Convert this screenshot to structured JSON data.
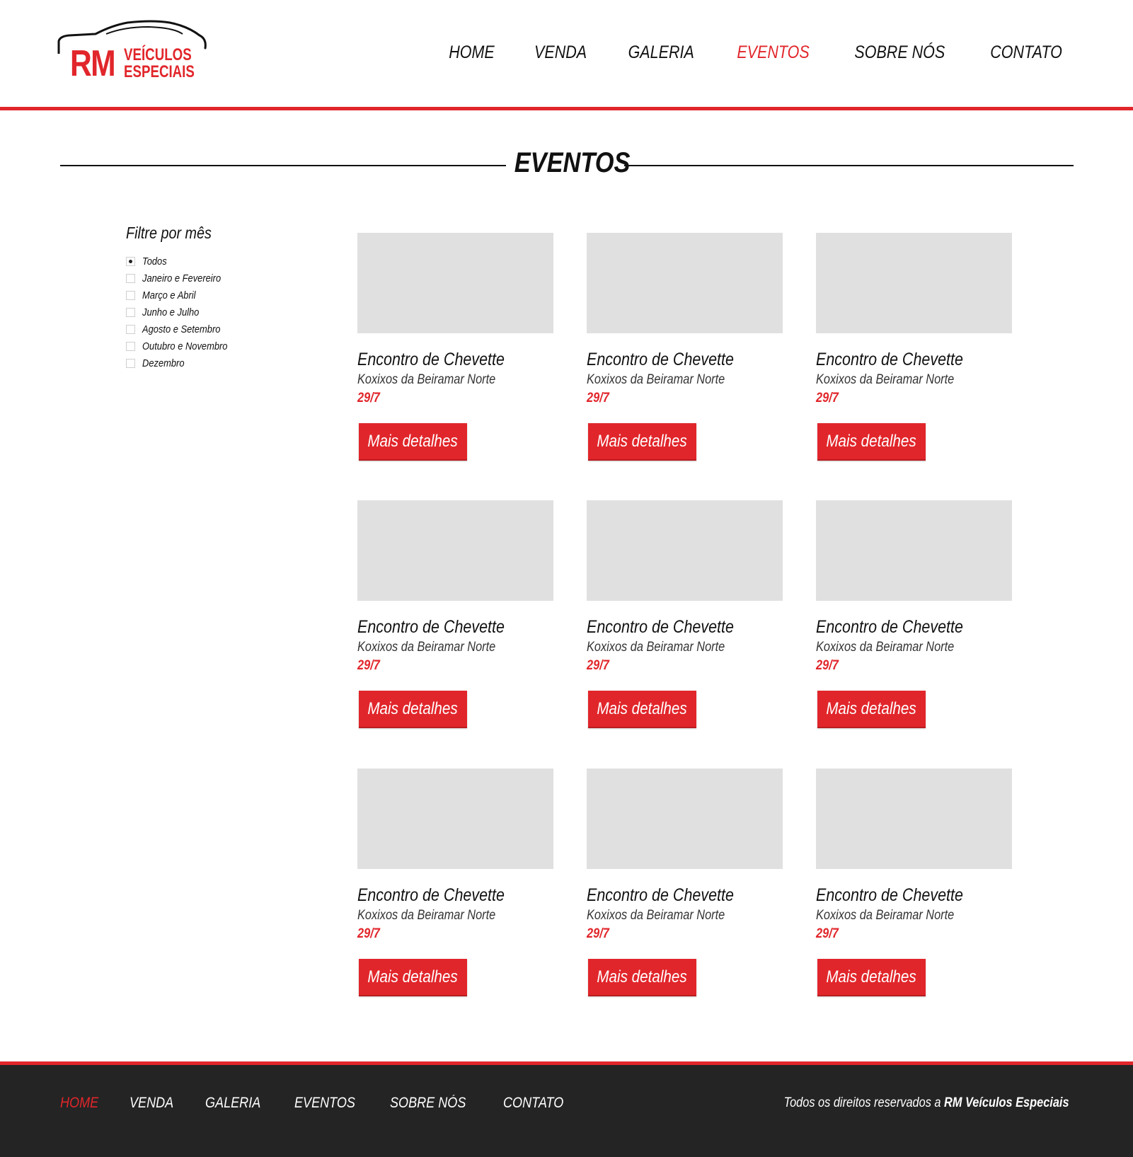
{
  "brand": {
    "logo_initials": "RM",
    "logo_line1": "VEÍCULOS",
    "logo_line2": "ESPECIAIS",
    "logo_icon": "car-silhouette-icon",
    "accent_color": "#e1262b",
    "footer_bg": "#242424"
  },
  "nav": {
    "items": [
      {
        "label": "HOME",
        "active": false
      },
      {
        "label": "VENDA",
        "active": false
      },
      {
        "label": "GALERIA",
        "active": false
      },
      {
        "label": "EVENTOS",
        "active": true
      },
      {
        "label": "SOBRE NÓS",
        "active": false
      },
      {
        "label": "CONTATO",
        "active": false
      }
    ]
  },
  "page": {
    "title": "EVENTOS"
  },
  "filter": {
    "title": "Filtre por mês",
    "options": [
      {
        "label": "Todos",
        "checked": true
      },
      {
        "label": "Janeiro e Fevereiro",
        "checked": false
      },
      {
        "label": "Março e Abril",
        "checked": false
      },
      {
        "label": "Junho e Julho",
        "checked": false
      },
      {
        "label": "Agosto e Setembro",
        "checked": false
      },
      {
        "label": "Outubro e Novembro",
        "checked": false
      },
      {
        "label": "Dezembro",
        "checked": false
      }
    ]
  },
  "events": [
    {
      "title": "Encontro de Chevette",
      "place": "Koxixos da Beiramar Norte",
      "date": "29/7",
      "button": "Mais detalhes"
    },
    {
      "title": "Encontro de Chevette",
      "place": "Koxixos da Beiramar Norte",
      "date": "29/7",
      "button": "Mais detalhes"
    },
    {
      "title": "Encontro de Chevette",
      "place": "Koxixos da Beiramar Norte",
      "date": "29/7",
      "button": "Mais detalhes"
    },
    {
      "title": "Encontro de Chevette",
      "place": "Koxixos da Beiramar Norte",
      "date": "29/7",
      "button": "Mais detalhes"
    },
    {
      "title": "Encontro de Chevette",
      "place": "Koxixos da Beiramar Norte",
      "date": "29/7",
      "button": "Mais detalhes"
    },
    {
      "title": "Encontro de Chevette",
      "place": "Koxixos da Beiramar Norte",
      "date": "29/7",
      "button": "Mais detalhes"
    },
    {
      "title": "Encontro de Chevette",
      "place": "Koxixos da Beiramar Norte",
      "date": "29/7",
      "button": "Mais detalhes"
    },
    {
      "title": "Encontro de Chevette",
      "place": "Koxixos da Beiramar Norte",
      "date": "29/7",
      "button": "Mais detalhes"
    },
    {
      "title": "Encontro de Chevette",
      "place": "Koxixos da Beiramar Norte",
      "date": "29/7",
      "button": "Mais detalhes"
    }
  ],
  "footer": {
    "nav": [
      {
        "label": "HOME",
        "active": true
      },
      {
        "label": "VENDA",
        "active": false
      },
      {
        "label": "GALERIA",
        "active": false
      },
      {
        "label": "EVENTOS",
        "active": false
      },
      {
        "label": "SOBRE NÓS",
        "active": false
      },
      {
        "label": "CONTATO",
        "active": false
      }
    ],
    "copyright_prefix": "Todos os direitos reservados a ",
    "copyright_brand": "RM Veículos Especiais"
  }
}
